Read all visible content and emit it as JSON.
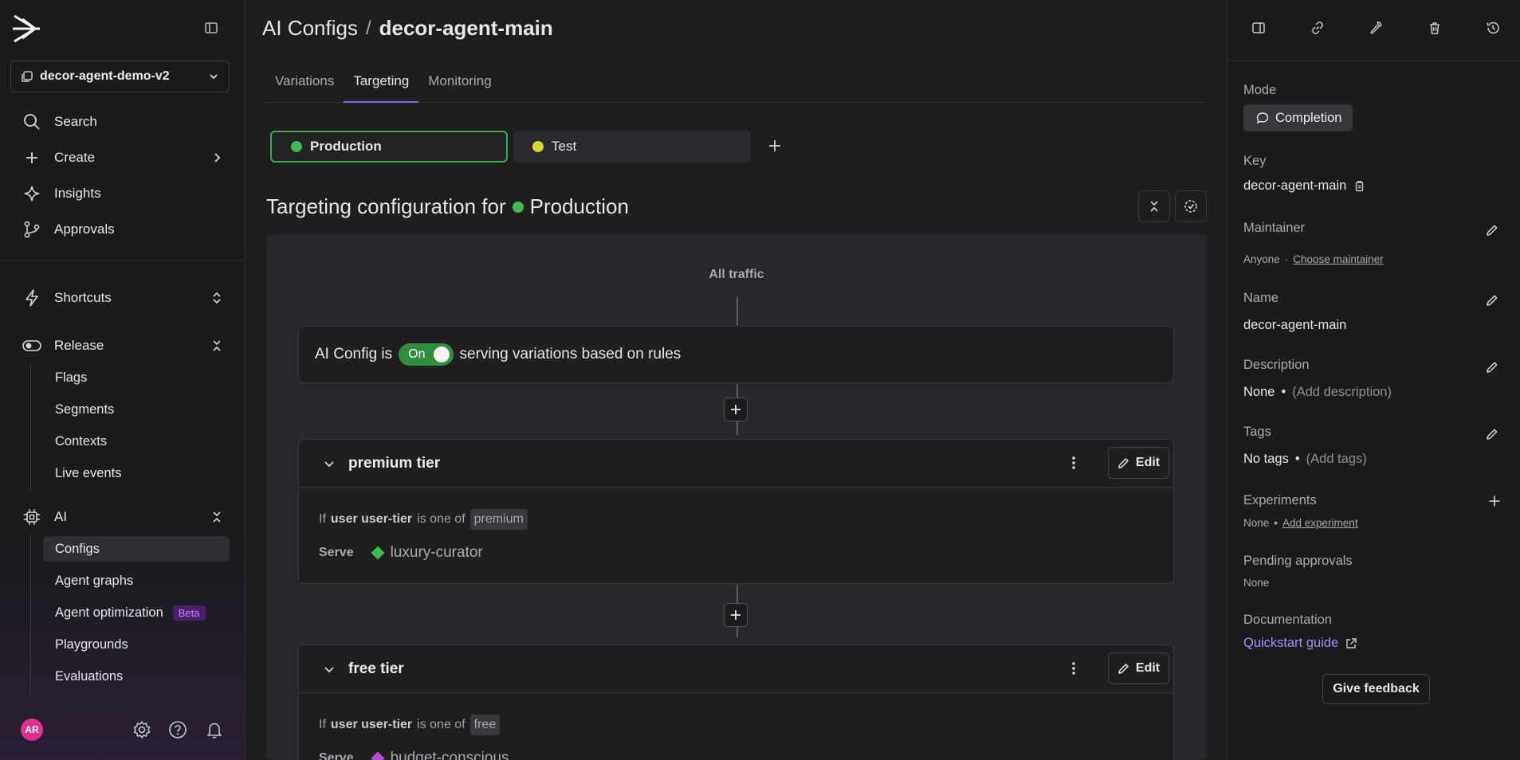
{
  "sidebar": {
    "project": "decor-agent-demo-v2",
    "nav": [
      {
        "label": "Search"
      },
      {
        "label": "Create"
      },
      {
        "label": "Insights"
      },
      {
        "label": "Approvals"
      }
    ],
    "sections": {
      "shortcuts": "Shortcuts",
      "release": "Release",
      "release_items": [
        "Flags",
        "Segments",
        "Contexts",
        "Live events"
      ],
      "ai": "AI",
      "ai_items": [
        "Configs",
        "Agent graphs",
        "Agent optimization",
        "Playgrounds",
        "Evaluations"
      ],
      "beta_badge": "Beta"
    },
    "user_initials": "AR"
  },
  "header": {
    "breadcrumb_root": "AI Configs",
    "separator": "/",
    "current": "decor-agent-main"
  },
  "tabs": [
    "Variations",
    "Targeting",
    "Monitoring"
  ],
  "environments": [
    {
      "name": "Production",
      "color": "#3fb950"
    },
    {
      "name": "Test",
      "color": "#d6d630"
    }
  ],
  "targeting": {
    "title_prefix": "Targeting configuration for",
    "environment": "Production",
    "all_traffic": "All traffic",
    "status_prefix": "AI Config is",
    "toggle": "On",
    "status_suffix": "serving variations based on rules",
    "rules": [
      {
        "name": "premium tier",
        "if": "If",
        "attribute": "user user-tier",
        "op": "is one of",
        "value": "premium",
        "serve_label": "Serve",
        "variation": "luxury-curator",
        "variation_color": "#3fb950",
        "edit": "Edit"
      },
      {
        "name": "free tier",
        "if": "If",
        "attribute": "user user-tier",
        "op": "is one of",
        "value": "free",
        "serve_label": "Serve",
        "variation": "budget-conscious",
        "variation_color": "#b44fd6",
        "edit": "Edit"
      }
    ]
  },
  "panel": {
    "mode_label": "Mode",
    "mode": "Completion",
    "key_label": "Key",
    "key": "decor-agent-main",
    "maintainer_label": "Maintainer",
    "maintainer": "Anyone",
    "choose_maintainer": "Choose maintainer",
    "name_label": "Name",
    "name": "decor-agent-main",
    "description_label": "Description",
    "description": "None",
    "add_description": "(Add description)",
    "tags_label": "Tags",
    "tags": "No tags",
    "add_tags": "(Add tags)",
    "experiments_label": "Experiments",
    "experiments": "None",
    "add_experiment": "Add experiment",
    "pending_label": "Pending approvals",
    "pending": "None",
    "docs_label": "Documentation",
    "quickstart": "Quickstart guide",
    "feedback": "Give feedback"
  }
}
